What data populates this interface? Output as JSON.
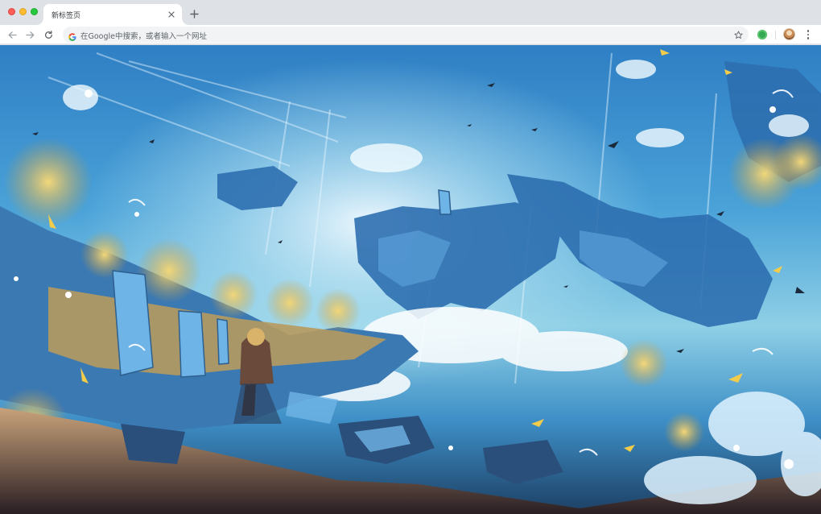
{
  "window": {
    "controls": [
      "close",
      "minimize",
      "zoom"
    ]
  },
  "tabs": [
    {
      "label": "新标签页",
      "active": true,
      "close_icon": "close-icon"
    }
  ],
  "new_tab_icon": "plus-icon",
  "toolbar": {
    "back_icon": "arrow-left-icon",
    "forward_icon": "arrow-right-icon",
    "reload_icon": "reload-icon",
    "omnibox": {
      "engine_icon": "google-g-icon",
      "placeholder": "在Google中搜索，或者输入一个网址",
      "bookmark_icon": "star-icon"
    },
    "extension_icon": "green-extension-icon",
    "profile_icon": "avatar",
    "menu_icon": "more-vertical-icon"
  },
  "colors": {
    "tabstrip": "#dee1e6",
    "toolbar": "#ffffff",
    "omnibox": "#f1f3f4",
    "accent_green": "#34a853",
    "sky_blue": "#2f7fc4",
    "gold_foliage": "#e6c65a"
  },
  "wallpaper": {
    "description_icon": "fantasy-floating-islands-wallpaper"
  }
}
